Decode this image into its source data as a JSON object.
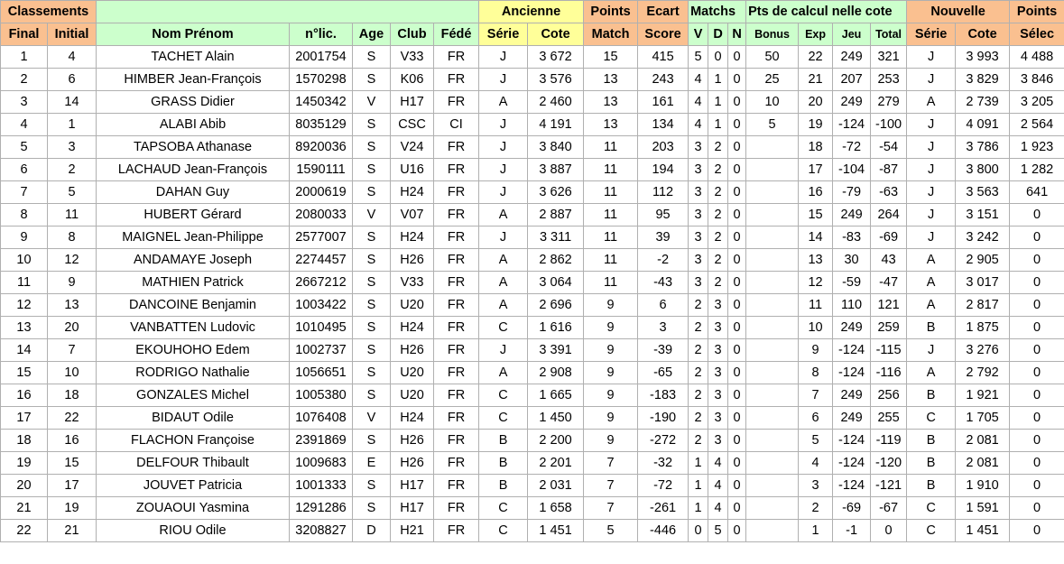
{
  "headers": {
    "classements": "Classements",
    "final": "Final",
    "initial": "Initial",
    "nom_prenom": "Nom Prénom",
    "nlic": "n°lic.",
    "age": "Age",
    "club": "Club",
    "fede": "Fédé",
    "ancienne": "Ancienne",
    "serie": "Série",
    "cote": "Cote",
    "points": "Points",
    "match": "Match",
    "ecart": "Ecart",
    "score": "Score",
    "matchs": "Matchs",
    "v": "V",
    "d": "D",
    "n": "N",
    "pts_calcul": "Pts de calcul nelle cote",
    "bonus": "Bonus",
    "exp": "Exp",
    "jeu": "Jeu",
    "total": "Total",
    "nouvelle": "Nouvelle",
    "serie2": "Série",
    "cote2": "Cote",
    "points_selec": "Points",
    "selec": "Sélec"
  },
  "colors": {
    "green": "#ccffcc",
    "yellow": "#ffff99",
    "orange": "#fac090"
  },
  "rows": [
    [
      "1",
      "4",
      "TACHET Alain",
      "2001754",
      "S",
      "V33",
      "FR",
      "J",
      "3 672",
      "15",
      "415",
      "5",
      "0",
      "0",
      "50",
      "22",
      "249",
      "321",
      "J",
      "3 993",
      "4 488"
    ],
    [
      "2",
      "6",
      "HIMBER Jean-François",
      "1570298",
      "S",
      "K06",
      "FR",
      "J",
      "3 576",
      "13",
      "243",
      "4",
      "1",
      "0",
      "25",
      "21",
      "207",
      "253",
      "J",
      "3 829",
      "3 846"
    ],
    [
      "3",
      "14",
      "GRASS Didier",
      "1450342",
      "V",
      "H17",
      "FR",
      "A",
      "2 460",
      "13",
      "161",
      "4",
      "1",
      "0",
      "10",
      "20",
      "249",
      "279",
      "A",
      "2 739",
      "3 205"
    ],
    [
      "4",
      "1",
      "ALABI Abib",
      "8035129",
      "S",
      "CSC",
      "CI",
      "J",
      "4 191",
      "13",
      "134",
      "4",
      "1",
      "0",
      "5",
      "19",
      "-124",
      "-100",
      "J",
      "4 091",
      "2 564"
    ],
    [
      "5",
      "3",
      "TAPSOBA Athanase",
      "8920036",
      "S",
      "V24",
      "FR",
      "J",
      "3 840",
      "11",
      "203",
      "3",
      "2",
      "0",
      "",
      "18",
      "-72",
      "-54",
      "J",
      "3 786",
      "1 923"
    ],
    [
      "6",
      "2",
      "LACHAUD Jean-François",
      "1590111",
      "S",
      "U16",
      "FR",
      "J",
      "3 887",
      "11",
      "194",
      "3",
      "2",
      "0",
      "",
      "17",
      "-104",
      "-87",
      "J",
      "3 800",
      "1 282"
    ],
    [
      "7",
      "5",
      "DAHAN Guy",
      "2000619",
      "S",
      "H24",
      "FR",
      "J",
      "3 626",
      "11",
      "112",
      "3",
      "2",
      "0",
      "",
      "16",
      "-79",
      "-63",
      "J",
      "3 563",
      "641"
    ],
    [
      "8",
      "11",
      "HUBERT Gérard",
      "2080033",
      "V",
      "V07",
      "FR",
      "A",
      "2 887",
      "11",
      "95",
      "3",
      "2",
      "0",
      "",
      "15",
      "249",
      "264",
      "J",
      "3 151",
      "0"
    ],
    [
      "9",
      "8",
      "MAIGNEL Jean-Philippe",
      "2577007",
      "S",
      "H24",
      "FR",
      "J",
      "3 311",
      "11",
      "39",
      "3",
      "2",
      "0",
      "",
      "14",
      "-83",
      "-69",
      "J",
      "3 242",
      "0"
    ],
    [
      "10",
      "12",
      "ANDAMAYE Joseph",
      "2274457",
      "S",
      "H26",
      "FR",
      "A",
      "2 862",
      "11",
      "-2",
      "3",
      "2",
      "0",
      "",
      "13",
      "30",
      "43",
      "A",
      "2 905",
      "0"
    ],
    [
      "11",
      "9",
      "MATHIEN Patrick",
      "2667212",
      "S",
      "V33",
      "FR",
      "A",
      "3 064",
      "11",
      "-43",
      "3",
      "2",
      "0",
      "",
      "12",
      "-59",
      "-47",
      "A",
      "3 017",
      "0"
    ],
    [
      "12",
      "13",
      "DANCOINE Benjamin",
      "1003422",
      "S",
      "U20",
      "FR",
      "A",
      "2 696",
      "9",
      "6",
      "2",
      "3",
      "0",
      "",
      "11",
      "110",
      "121",
      "A",
      "2 817",
      "0"
    ],
    [
      "13",
      "20",
      "VANBATTEN Ludovic",
      "1010495",
      "S",
      "H24",
      "FR",
      "C",
      "1 616",
      "9",
      "3",
      "2",
      "3",
      "0",
      "",
      "10",
      "249",
      "259",
      "B",
      "1 875",
      "0"
    ],
    [
      "14",
      "7",
      "EKOUHOHO Edem",
      "1002737",
      "S",
      "H26",
      "FR",
      "J",
      "3 391",
      "9",
      "-39",
      "2",
      "3",
      "0",
      "",
      "9",
      "-124",
      "-115",
      "J",
      "3 276",
      "0"
    ],
    [
      "15",
      "10",
      "RODRIGO Nathalie",
      "1056651",
      "S",
      "U20",
      "FR",
      "A",
      "2 908",
      "9",
      "-65",
      "2",
      "3",
      "0",
      "",
      "8",
      "-124",
      "-116",
      "A",
      "2 792",
      "0"
    ],
    [
      "16",
      "18",
      "GONZALES Michel",
      "1005380",
      "S",
      "U20",
      "FR",
      "C",
      "1 665",
      "9",
      "-183",
      "2",
      "3",
      "0",
      "",
      "7",
      "249",
      "256",
      "B",
      "1 921",
      "0"
    ],
    [
      "17",
      "22",
      "BIDAUT Odile",
      "1076408",
      "V",
      "H24",
      "FR",
      "C",
      "1 450",
      "9",
      "-190",
      "2",
      "3",
      "0",
      "",
      "6",
      "249",
      "255",
      "C",
      "1 705",
      "0"
    ],
    [
      "18",
      "16",
      "FLACHON Françoise",
      "2391869",
      "S",
      "H26",
      "FR",
      "B",
      "2 200",
      "9",
      "-272",
      "2",
      "3",
      "0",
      "",
      "5",
      "-124",
      "-119",
      "B",
      "2 081",
      "0"
    ],
    [
      "19",
      "15",
      "DELFOUR Thibault",
      "1009683",
      "E",
      "H26",
      "FR",
      "B",
      "2 201",
      "7",
      "-32",
      "1",
      "4",
      "0",
      "",
      "4",
      "-124",
      "-120",
      "B",
      "2 081",
      "0"
    ],
    [
      "20",
      "17",
      "JOUVET Patricia",
      "1001333",
      "S",
      "H17",
      "FR",
      "B",
      "2 031",
      "7",
      "-72",
      "1",
      "4",
      "0",
      "",
      "3",
      "-124",
      "-121",
      "B",
      "1 910",
      "0"
    ],
    [
      "21",
      "19",
      "ZOUAOUI Yasmina",
      "1291286",
      "S",
      "H17",
      "FR",
      "C",
      "1 658",
      "7",
      "-261",
      "1",
      "4",
      "0",
      "",
      "2",
      "-69",
      "-67",
      "C",
      "1 591",
      "0"
    ],
    [
      "22",
      "21",
      "RIOU Odile",
      "3208827",
      "D",
      "H21",
      "FR",
      "C",
      "1 451",
      "5",
      "-446",
      "0",
      "5",
      "0",
      "",
      "1",
      "-1",
      "0",
      "C",
      "1 451",
      "0"
    ]
  ]
}
